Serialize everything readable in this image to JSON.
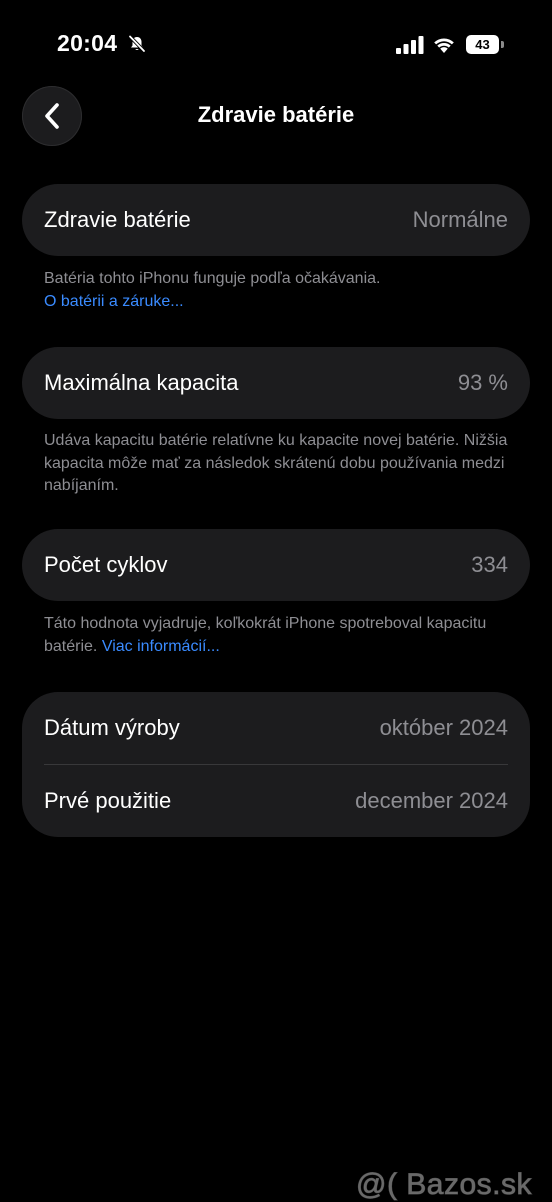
{
  "status_bar": {
    "time": "20:04",
    "battery_level": "43",
    "icons": [
      "bell-slash-icon",
      "cellular-signal-icon",
      "wifi-icon",
      "battery-icon"
    ]
  },
  "nav": {
    "title": "Zdravie batérie",
    "back_icon": "chevron-left-icon"
  },
  "health": {
    "label": "Zdravie batérie",
    "value": "Normálne",
    "footnote_text": "Batéria tohto iPhonu funguje podľa očakávania.",
    "footnote_link": "O batérii a záruke..."
  },
  "capacity": {
    "label": "Maximálna kapacita",
    "value": "93 %",
    "footnote_text": "Udáva kapacitu batérie relatívne ku kapacite novej batérie. Nižšia kapacita môže mať za následok skrátenú dobu používania medzi nabíjaním."
  },
  "cycles": {
    "label": "Počet cyklov",
    "value": "334",
    "footnote_text": "Táto hodnota vyjadruje, koľkokrát iPhone spotreboval kapacitu batérie. ",
    "footnote_link": "Viac informácií..."
  },
  "dates": {
    "manufacture_label": "Dátum výroby",
    "manufacture_value": "október 2024",
    "first_use_label": "Prvé použitie",
    "first_use_value": "december 2024"
  },
  "watermark": "@( Bazos.sk",
  "colors": {
    "background": "#000000",
    "card": "#1c1c1e",
    "secondary_text": "#8e8e93",
    "link": "#3a8bff"
  }
}
